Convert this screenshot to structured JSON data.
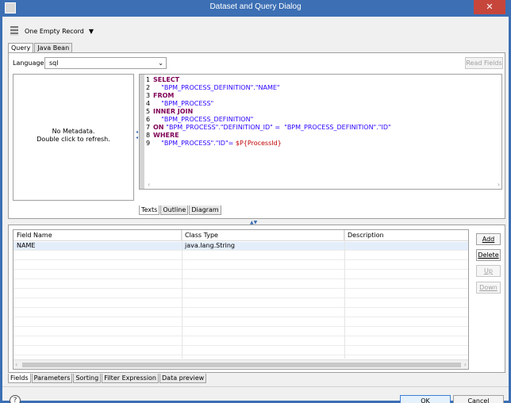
{
  "window": {
    "title": "Dataset and Query Dialog",
    "close_label": "✕"
  },
  "toolbar": {
    "record_label": "One Empty Record",
    "dropdown_caret": "▼"
  },
  "top_tabs": [
    "Query",
    "Java Bean"
  ],
  "query": {
    "language_label": "Language",
    "language_value": "sql",
    "read_fields_label": "Read Fields",
    "metadata_line1": "No Metadata.",
    "metadata_line2": "Double click to refresh.",
    "sql_lines": [
      {
        "num": "1",
        "parts": [
          {
            "t": "SELECT",
            "c": "kw"
          }
        ]
      },
      {
        "num": "2",
        "parts": [
          {
            "t": "    \"BPM_PROCESS_DEFINITION\".\"NAME\"",
            "c": "str"
          }
        ]
      },
      {
        "num": "3",
        "parts": [
          {
            "t": "FROM",
            "c": "kw"
          }
        ]
      },
      {
        "num": "4",
        "parts": [
          {
            "t": "    \"BPM_PROCESS\"",
            "c": "str"
          }
        ]
      },
      {
        "num": "5",
        "parts": [
          {
            "t": "INNER JOIN",
            "c": "kw"
          }
        ]
      },
      {
        "num": "6",
        "parts": [
          {
            "t": "    \"BPM_PROCESS_DEFINITION\"",
            "c": "str"
          }
        ]
      },
      {
        "num": "7",
        "parts": [
          {
            "t": "ON ",
            "c": "kw"
          },
          {
            "t": "\"BPM_PROCESS\".\"DEFINITION_ID\" =  \"BPM_PROCESS_DEFINITION\".\"ID\"",
            "c": "str"
          }
        ]
      },
      {
        "num": "8",
        "parts": [
          {
            "t": "WHERE",
            "c": "kw"
          }
        ]
      },
      {
        "num": "9",
        "parts": [
          {
            "t": "    \"BPM_PROCESS\".\"ID\"= ",
            "c": "str"
          },
          {
            "t": "$P{ProcessId}",
            "c": "prm"
          }
        ]
      }
    ],
    "editor_tabs": [
      "Texts",
      "Outline",
      "Diagram"
    ]
  },
  "fields": {
    "columns": [
      "Field Name",
      "Class Type",
      "Description"
    ],
    "rows": [
      {
        "name": "NAME",
        "class_type": "java.lang.String",
        "description": ""
      }
    ],
    "buttons": {
      "add": "Add",
      "delete": "Delete",
      "up": "Up",
      "down": "Down"
    }
  },
  "bottom_tabs": [
    "Fields",
    "Parameters",
    "Sorting",
    "Filter Expression",
    "Data preview"
  ],
  "footer": {
    "help": "?",
    "ok": "OK",
    "cancel": "Cancel"
  }
}
